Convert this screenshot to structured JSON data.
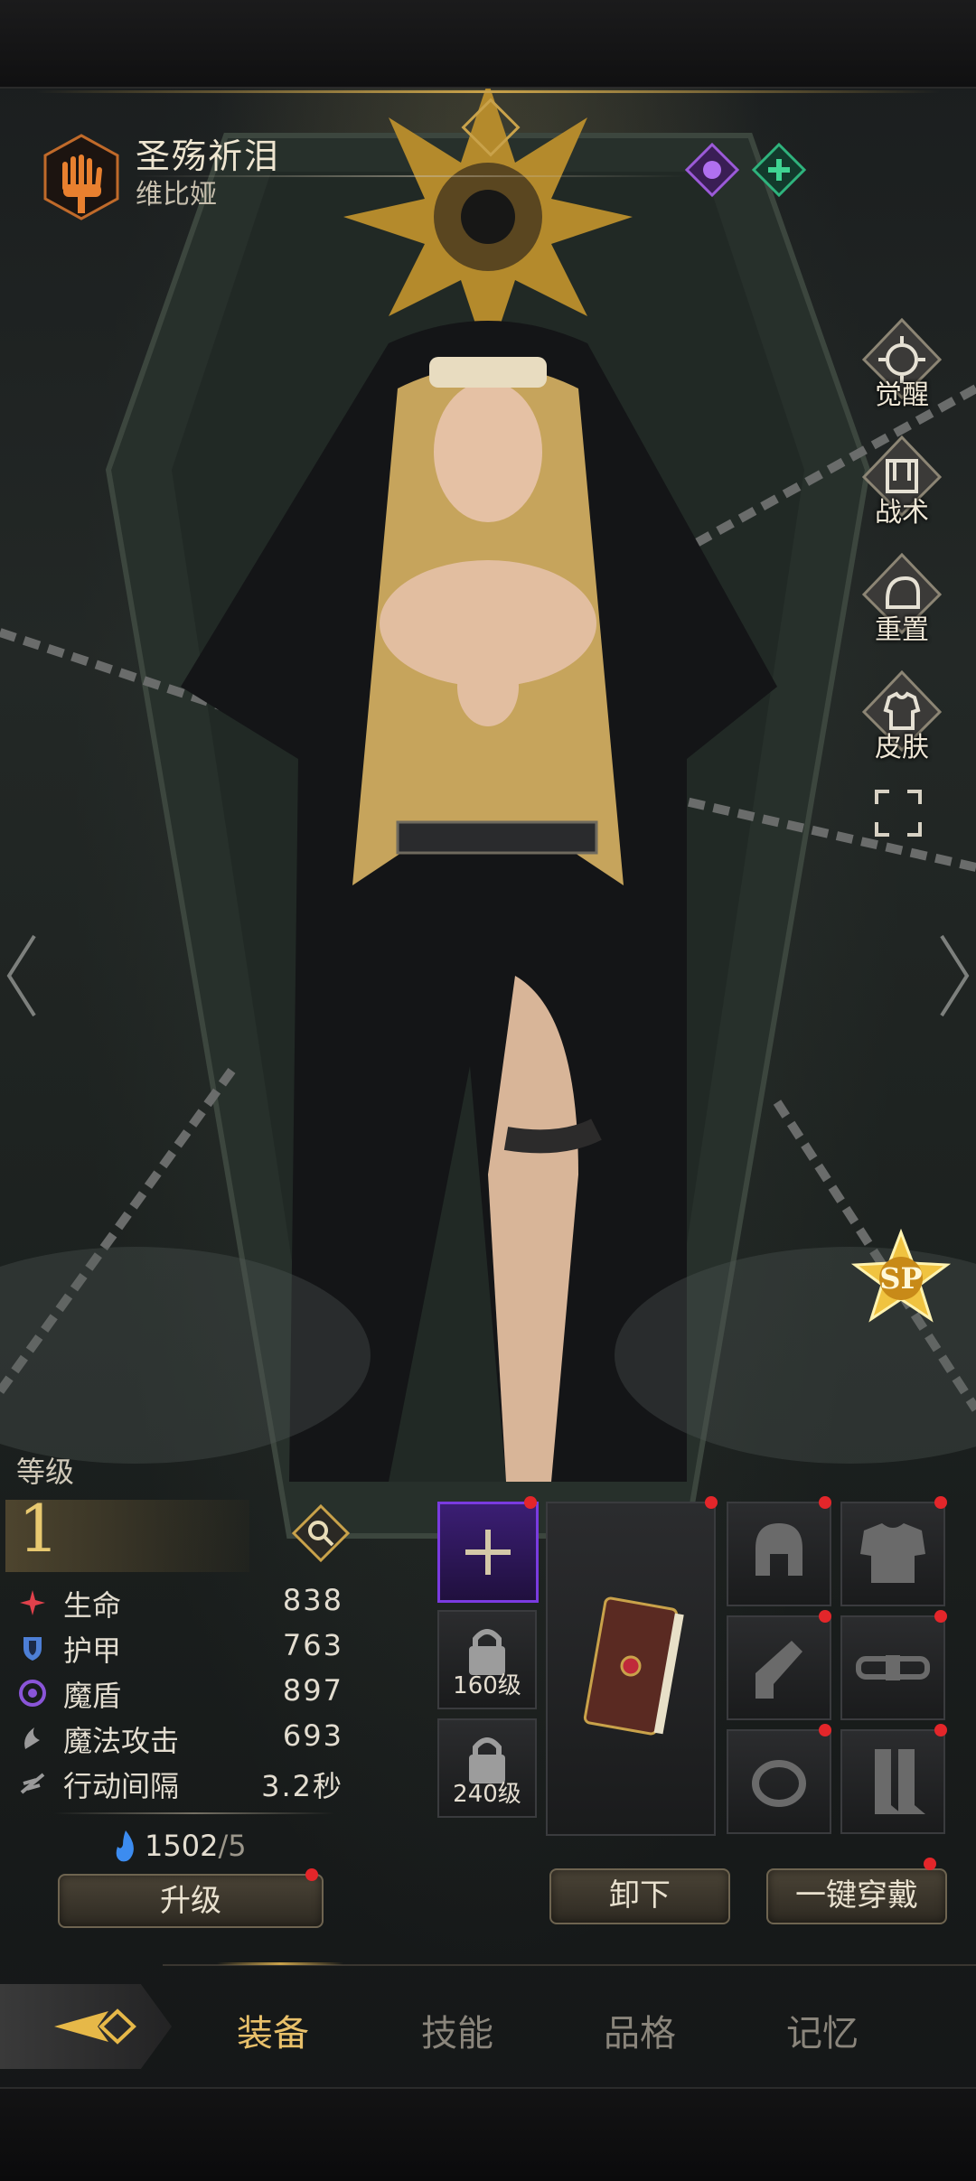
{
  "hero": {
    "name": "圣殇祈泪",
    "subtitle": "维比娅"
  },
  "side_tools": [
    {
      "label": "觉醒",
      "icon": "awaken-icon"
    },
    {
      "label": "战术",
      "icon": "tactics-icon"
    },
    {
      "label": "重置",
      "icon": "reset-icon"
    },
    {
      "label": "皮肤",
      "icon": "skin-icon"
    }
  ],
  "rank_badge": "SP",
  "level": {
    "label": "等级",
    "value": "1"
  },
  "stats": [
    {
      "name": "生命",
      "value": "838",
      "icon": "health-icon",
      "color": "#e0414b"
    },
    {
      "name": "护甲",
      "value": "763",
      "icon": "armor-icon",
      "color": "#4d7fd6"
    },
    {
      "name": "魔盾",
      "value": "897",
      "icon": "magic-shield-icon",
      "color": "#8a55d8"
    },
    {
      "name": "魔法攻击",
      "value": "693",
      "icon": "magic-attack-icon",
      "color": "#9a9a9a"
    },
    {
      "name": "行动间隔",
      "value": "3.2秒",
      "icon": "action-interval-icon",
      "color": "#9a9a9a"
    }
  ],
  "resource": {
    "current": "1502",
    "required": "/5",
    "icon": "blue-flame-icon"
  },
  "buttons": {
    "upgrade": "升级",
    "unequip": "卸下",
    "equip_all": "一键穿戴"
  },
  "slots": {
    "locked": [
      "160级",
      "240级"
    ]
  },
  "tabs": [
    "装备",
    "技能",
    "品格",
    "记忆"
  ],
  "active_tab": "装备",
  "colors": {
    "gold": "#c9a24a",
    "accent": "#e8c06a",
    "red_dot": "#e3262a",
    "slot_purple": "#7a3be0"
  }
}
